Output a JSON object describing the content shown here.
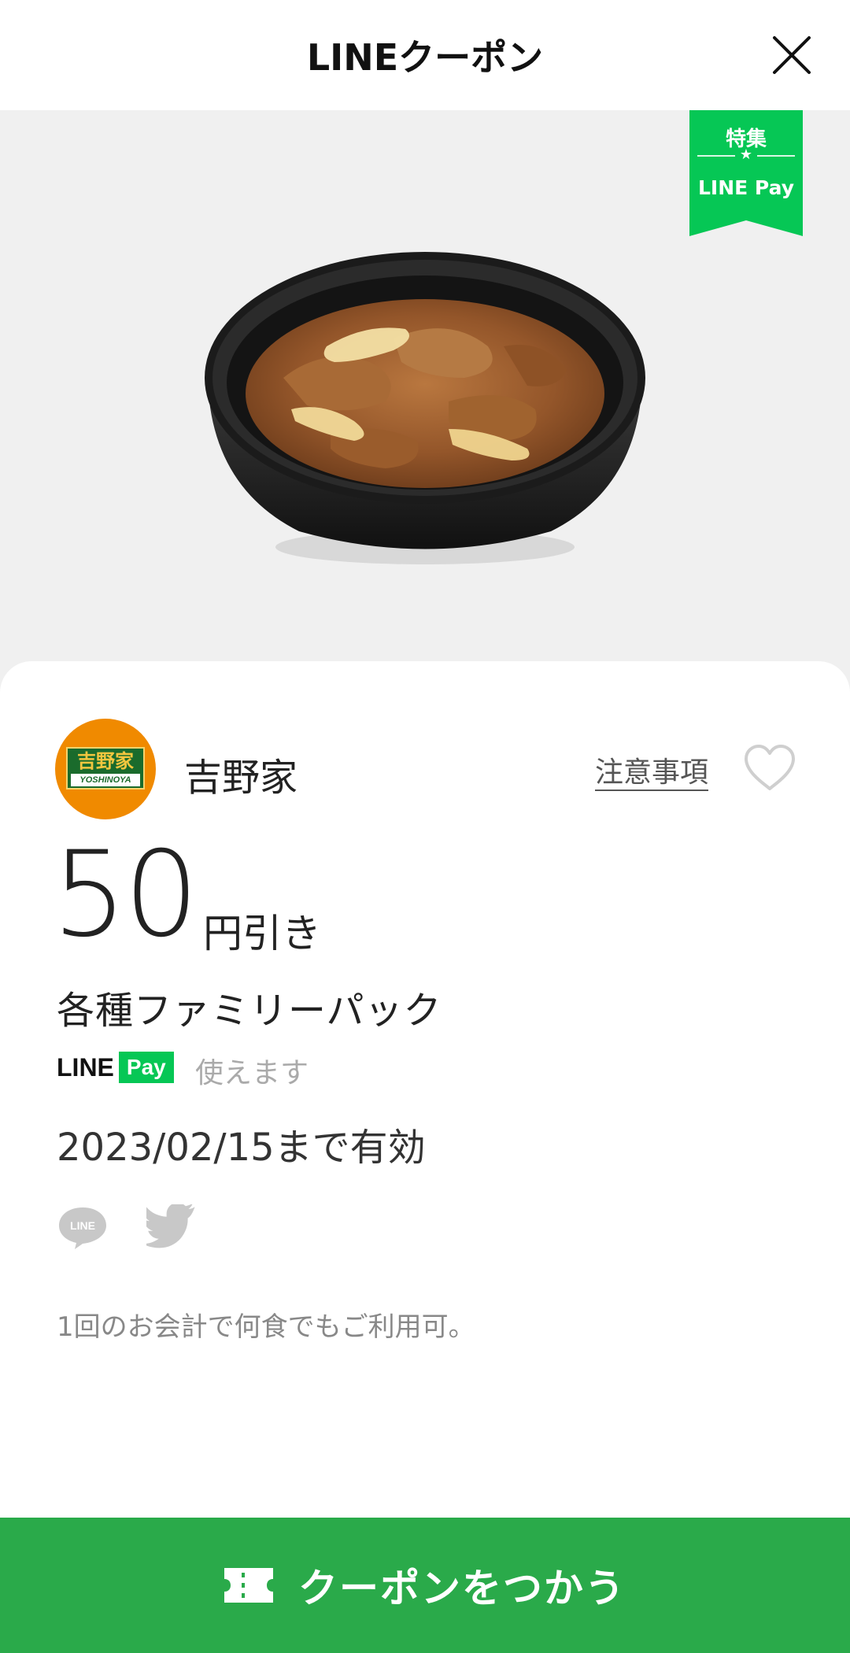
{
  "header": {
    "title": "LINEクーポン",
    "close_icon": "close-icon"
  },
  "hero": {
    "image_icon": "gyudon-bowl-image",
    "ribbon": {
      "top_label": "特集",
      "star": "★",
      "bottom_label": "LINE Pay",
      "color": "#06c755"
    }
  },
  "coupon": {
    "brand": {
      "name": "吉野家",
      "logo_kanji": "吉野家",
      "logo_roman": "YOSHINOYA",
      "logo_color": "#f08a00"
    },
    "notes_link": "注意事項",
    "favorite_icon": "heart-outline-icon",
    "discount_amount": "50",
    "discount_unit": "円引き",
    "item_name": "各種ファミリーパック",
    "payment": {
      "logo_line": "LINE",
      "logo_pay": "Pay",
      "status": "使えます"
    },
    "validity": "2023/02/15まで有効",
    "share": {
      "line_icon": "line-share-icon",
      "line_label": "LINE",
      "twitter_icon": "twitter-icon"
    },
    "usage_note": "1回のお会計で何食でもご利用可。"
  },
  "cta": {
    "label": "クーポンをつかう",
    "icon": "ticket-icon",
    "color": "#2aaa4a"
  }
}
